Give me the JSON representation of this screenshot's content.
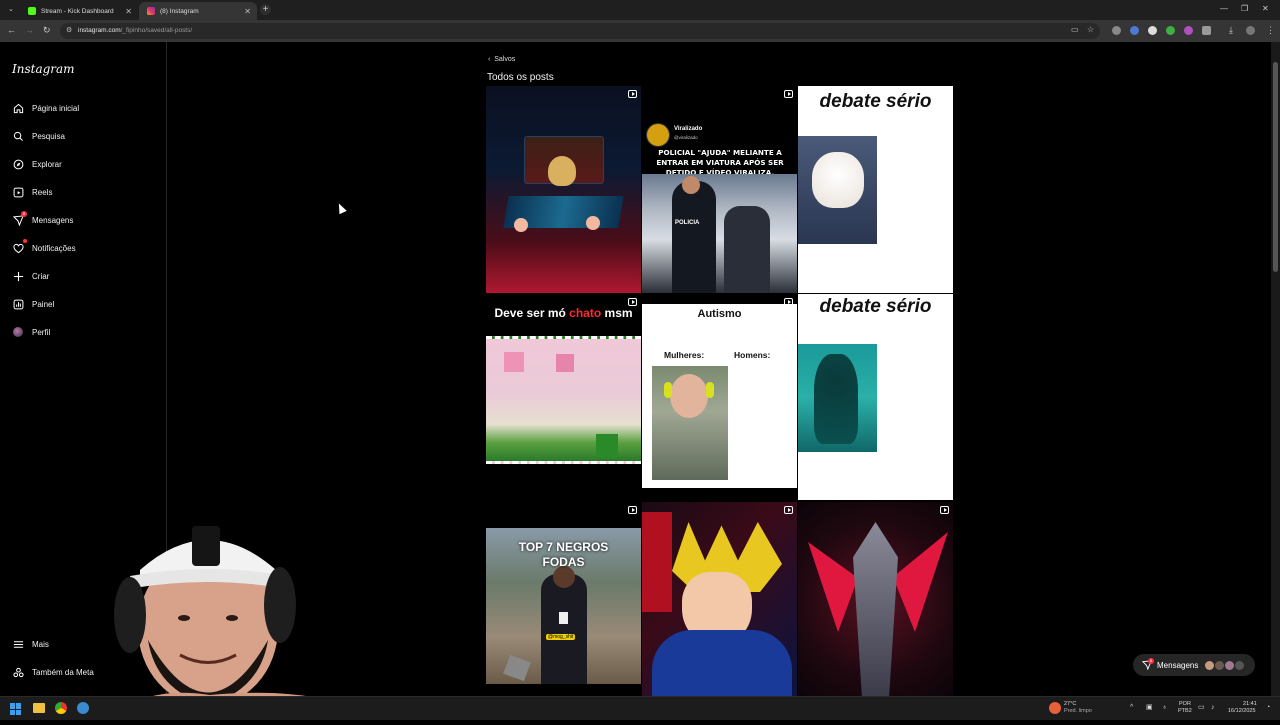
{
  "browser": {
    "tabs": [
      {
        "title": "Stream - Kick Dashboard",
        "favicon_color": "#53fc18"
      },
      {
        "title": "(8) Instagram",
        "favicon_color": "#e1306c"
      }
    ],
    "new_tab": "+",
    "url_main": "instagram.com",
    "url_path": "/_fipinho/saved/all-posts/"
  },
  "sidebar": {
    "logo": "Instagram",
    "items": [
      {
        "label": "Página inicial",
        "icon": "home-icon"
      },
      {
        "label": "Pesquisa",
        "icon": "search-icon"
      },
      {
        "label": "Explorar",
        "icon": "compass-icon"
      },
      {
        "label": "Reels",
        "icon": "reels-icon"
      },
      {
        "label": "Mensagens",
        "icon": "messenger-icon",
        "badge": "8"
      },
      {
        "label": "Notificações",
        "icon": "heart-icon"
      },
      {
        "label": "Criar",
        "icon": "plus-icon"
      },
      {
        "label": "Painel",
        "icon": "chart-icon"
      },
      {
        "label": "Perfil",
        "icon": "avatar-icon"
      }
    ],
    "bottom_items": [
      {
        "label": "Mais",
        "icon": "menu-icon"
      },
      {
        "label": "Também da Meta",
        "icon": "meta-icon"
      }
    ]
  },
  "main": {
    "back_label": "Salvos",
    "title": "Todos os posts",
    "posts": [
      {
        "reel": true,
        "overlay_lines": []
      },
      {
        "reel": true,
        "account": "Viralizado",
        "handle": "@viralizado",
        "caption": "POLICIAL \"AJUDA\" MELIANTE A ENTRAR EM VIATURA APÓS SER DETIDO E VÍDEO VIRALIZA.",
        "photo_text": "POLICIA"
      },
      {
        "reel": false,
        "caption": "debate sério"
      },
      {
        "reel": true,
        "caption_white": "Deve ser mó ",
        "caption_red": "chato",
        "caption_end": " msm"
      },
      {
        "reel": true,
        "caption": "Autismo",
        "left_label": "Mulheres:",
        "right_label": "Homens:"
      },
      {
        "reel": false,
        "caption": "debate sério"
      },
      {
        "reel": true,
        "caption": "TOP 7 NEGROS FODAS",
        "tag": "@mog_shit"
      },
      {
        "reel": true
      },
      {
        "reel": true
      }
    ]
  },
  "messages_pill": {
    "label": "Mensagens",
    "badge": "8"
  },
  "taskbar": {
    "weather_temp": "27°C",
    "weather_desc": "Pred. limpo",
    "lang": "POR",
    "layout": "PTB2",
    "time": "21:41",
    "date": "16/12/2025"
  }
}
